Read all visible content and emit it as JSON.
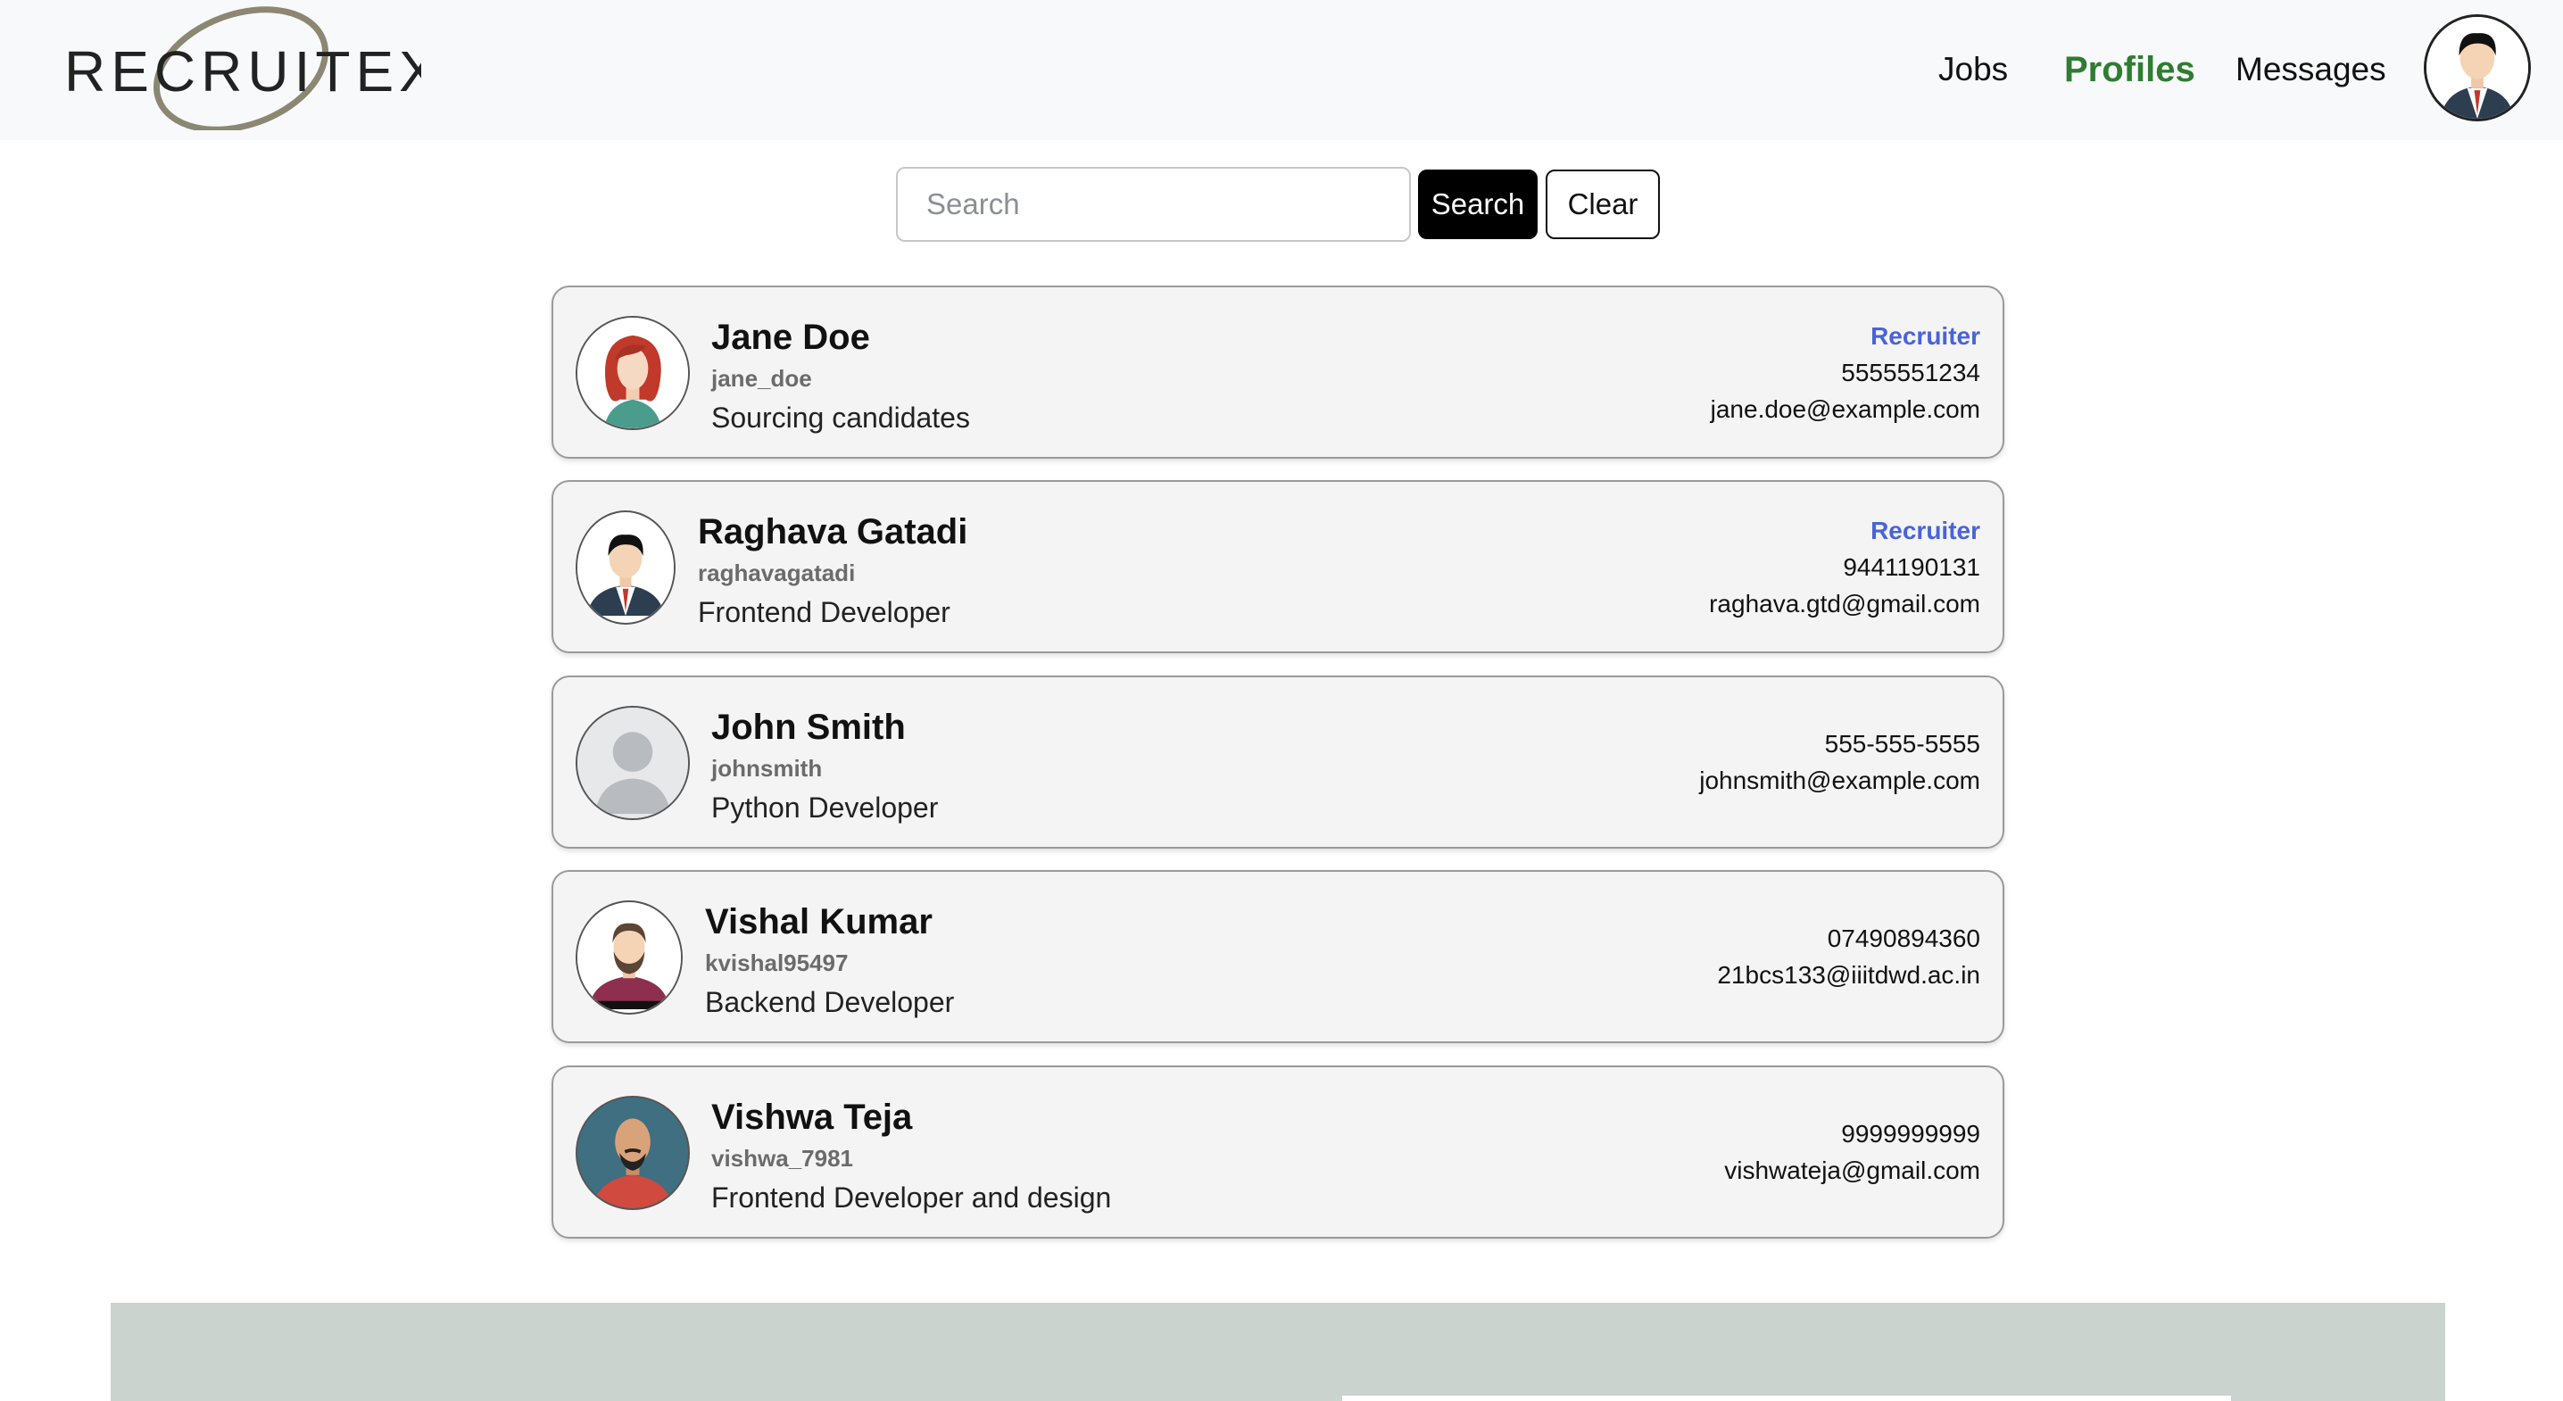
{
  "brand": {
    "logo_text": "RECRUITEX"
  },
  "nav": {
    "jobs": "Jobs",
    "profiles": "Profiles",
    "messages": "Messages",
    "active_color": "#2e7d32"
  },
  "search": {
    "placeholder": "Search",
    "value": "",
    "search_label": "Search",
    "clear_label": "Clear"
  },
  "profiles": [
    {
      "name": "Jane Doe",
      "username": "jane_doe",
      "title": "Sourcing candidates",
      "role": "Recruiter",
      "phone": "5555551234",
      "email": "jane.doe@example.com",
      "avatar": "woman-red-hair-icon"
    },
    {
      "name": "Raghava Gatadi",
      "username": "raghavagatadi",
      "title": "Frontend Developer",
      "role": "Recruiter",
      "phone": "9441190131",
      "email": "raghava.gtd@gmail.com",
      "avatar": "man-suit-icon"
    },
    {
      "name": "John Smith",
      "username": "johnsmith",
      "title": "Python Developer",
      "role": "",
      "phone": "555-555-5555",
      "email": "johnsmith@example.com",
      "avatar": "default-user-icon"
    },
    {
      "name": "Vishal Kumar",
      "username": "kvishal95497",
      "title": "Backend Developer",
      "role": "",
      "phone": "07490894360",
      "email": "21bcs133@iiitdwd.ac.in",
      "avatar": "bearded-man-icon"
    },
    {
      "name": "Vishwa Teja",
      "username": "vishwa_7981",
      "title": "Frontend Developer and design",
      "role": "",
      "phone": "9999999999",
      "email": "vishwateja@gmail.com",
      "avatar": "bald-man-icon"
    }
  ],
  "colors": {
    "role": "#4a63d8",
    "footer": "#cbd3ce"
  }
}
